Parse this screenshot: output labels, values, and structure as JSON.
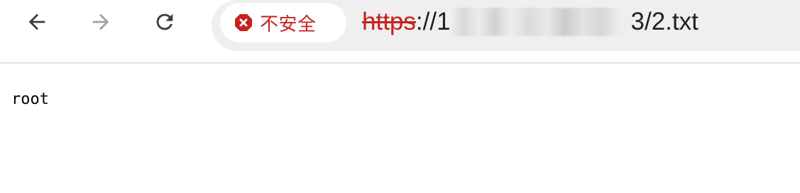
{
  "toolbar": {
    "back_icon": "arrow-left-icon",
    "forward_icon": "arrow-right-icon",
    "reload_icon": "reload-icon"
  },
  "omnibox": {
    "security_icon": "warning-icon",
    "security_label": "不安全",
    "url_scheme": "https",
    "url_after_scheme": "://1",
    "url_tail": "3/2.txt",
    "colors": {
      "warning_red": "#c5221f",
      "omnibox_bg": "#f0eff0"
    }
  },
  "page": {
    "text": "root"
  }
}
